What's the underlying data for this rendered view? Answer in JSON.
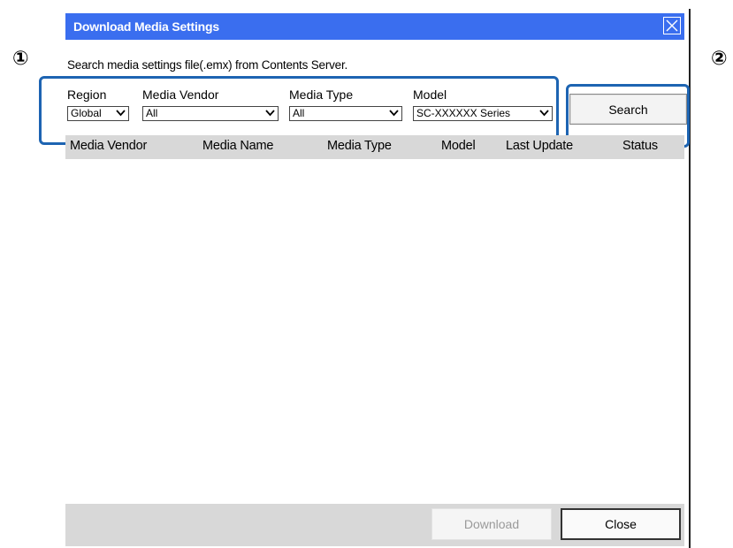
{
  "callouts": [
    "①",
    "②"
  ],
  "dialog": {
    "title": "Download Media Settings",
    "description": "Search media settings file(.emx) from Contents Server."
  },
  "filters": {
    "region": {
      "label": "Region",
      "value": "Global"
    },
    "media_vendor": {
      "label": "Media Vendor",
      "value": "All"
    },
    "media_type": {
      "label": "Media Type",
      "value": "All"
    },
    "model": {
      "label": "Model",
      "value": "SC-XXXXXX Series"
    }
  },
  "search_label": "Search",
  "table": {
    "columns": [
      "Media Vendor",
      "Media Name",
      "Media Type",
      "Model",
      "Last Update",
      "Status"
    ],
    "rows": []
  },
  "footer": {
    "download_label": "Download",
    "close_label": "Close"
  },
  "colors": {
    "titlebar": "#3a6eef",
    "highlight": "#1d64b2",
    "header_bg": "#d8d8d8"
  },
  "icons": {
    "close": "close-icon",
    "dropdown": "chevron-down-icon"
  }
}
